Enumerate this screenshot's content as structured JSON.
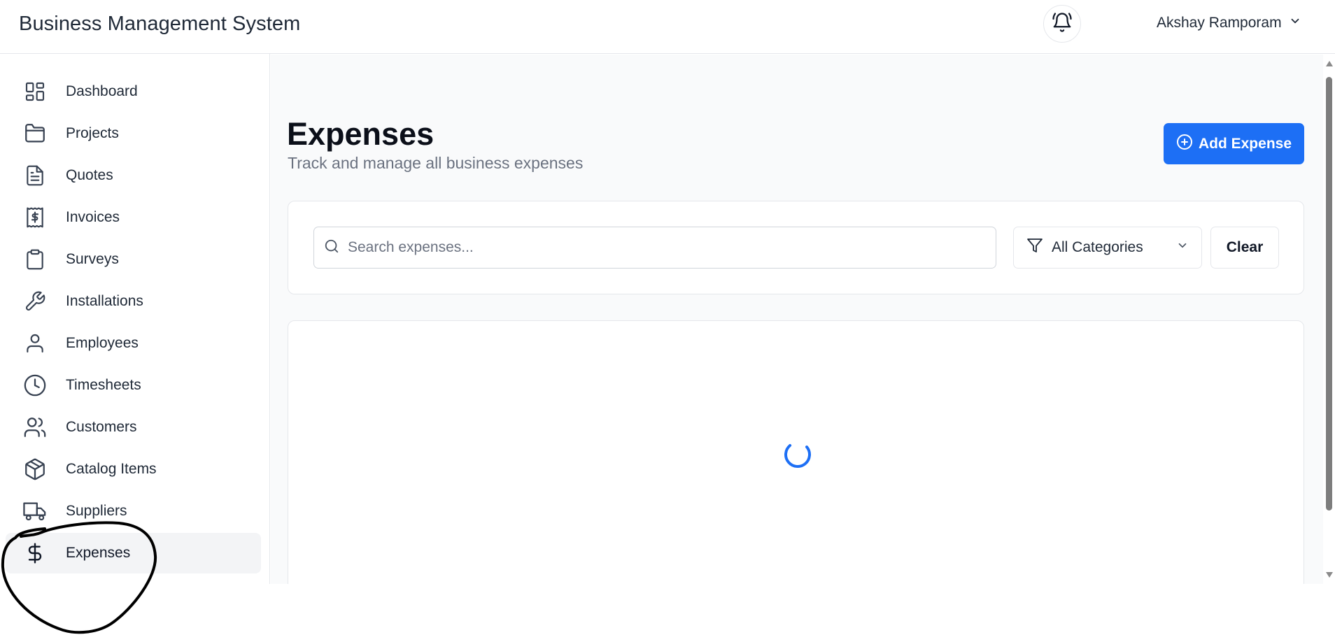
{
  "header": {
    "app_title": "Business Management System",
    "user_name": "Akshay Ramporam"
  },
  "sidebar": {
    "items": [
      {
        "label": "Dashboard",
        "icon": "dashboard-icon"
      },
      {
        "label": "Projects",
        "icon": "folder-icon"
      },
      {
        "label": "Quotes",
        "icon": "document-icon"
      },
      {
        "label": "Invoices",
        "icon": "receipt-icon"
      },
      {
        "label": "Surveys",
        "icon": "clipboard-icon"
      },
      {
        "label": "Installations",
        "icon": "wrench-icon"
      },
      {
        "label": "Employees",
        "icon": "user-icon"
      },
      {
        "label": "Timesheets",
        "icon": "clock-icon"
      },
      {
        "label": "Customers",
        "icon": "users-icon"
      },
      {
        "label": "Catalog Items",
        "icon": "package-icon"
      },
      {
        "label": "Suppliers",
        "icon": "truck-icon"
      },
      {
        "label": "Expenses",
        "icon": "dollar-icon",
        "active": true
      }
    ]
  },
  "main": {
    "title": "Expenses",
    "subtitle": "Track and manage all business expenses",
    "add_button_label": "Add Expense",
    "search": {
      "placeholder": "Search expenses...",
      "value": ""
    },
    "category_filter": {
      "selected": "All Categories"
    },
    "clear_button_label": "Clear",
    "loading": true
  },
  "colors": {
    "accent": "#1d6ff5",
    "active_nav_bg": "#f3f4f6",
    "main_bg": "#f9fafb"
  }
}
